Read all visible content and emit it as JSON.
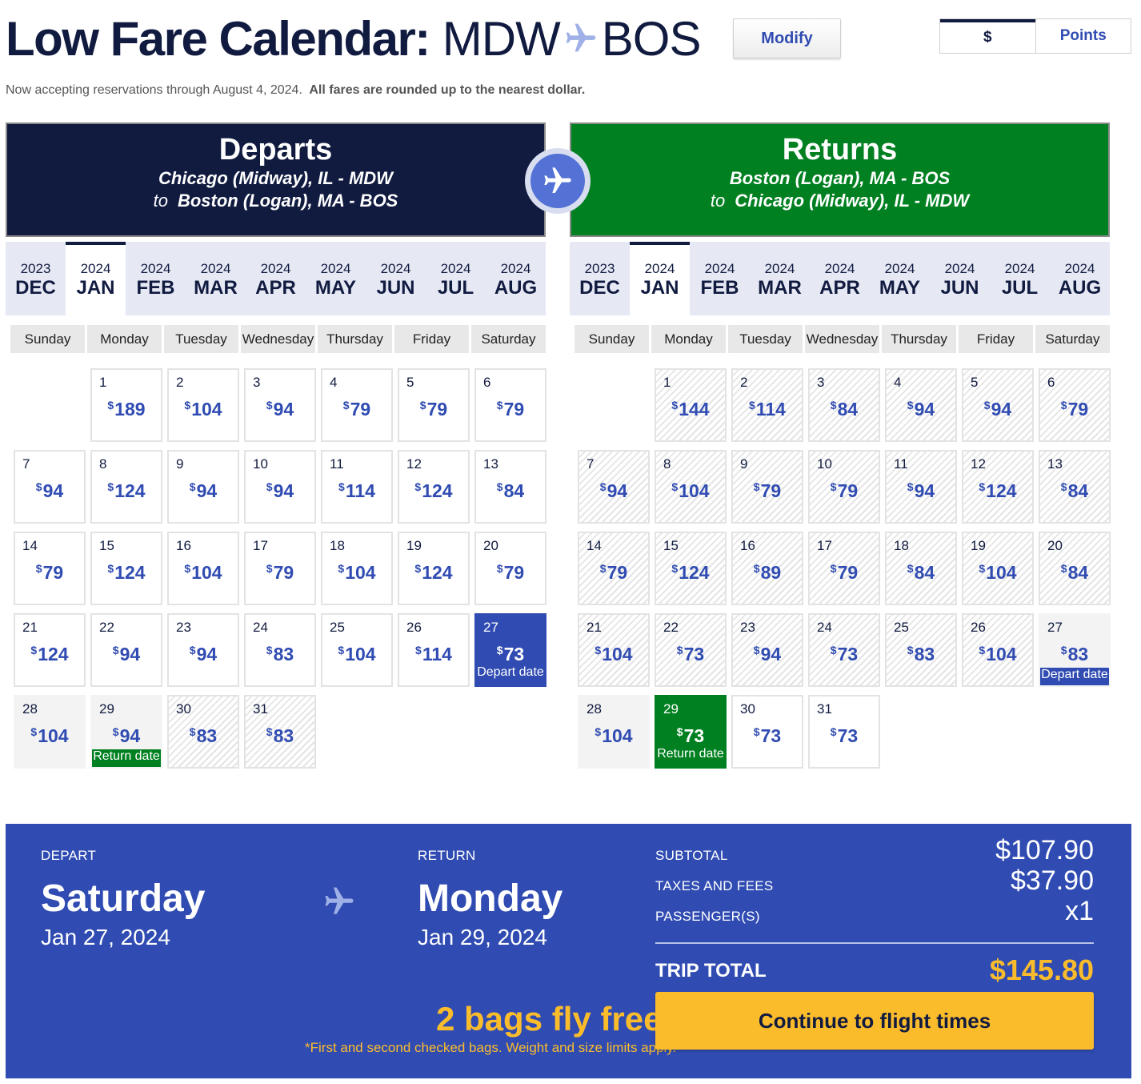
{
  "header": {
    "title": "Low Fare Calendar:",
    "origin": "MDW",
    "destination": "BOS",
    "modify_label": "Modify",
    "currency_options": [
      "$",
      "Points"
    ],
    "currency_selected": "$"
  },
  "notice": {
    "text": "Now accepting reservations through August 4, 2024.",
    "bold": "All fares are rounded up to the nearest dollar."
  },
  "colors": {
    "navy": "#111b40",
    "blue": "#304cb2",
    "green": "#008020",
    "yellow": "#fbbc2c"
  },
  "depart": {
    "heading": "Departs",
    "from": "Chicago (Midway), IL - MDW",
    "to_word": "to",
    "to": "Boston (Logan), MA - BOS",
    "months": [
      {
        "year": "2023",
        "name": "DEC"
      },
      {
        "year": "2024",
        "name": "JAN"
      },
      {
        "year": "2024",
        "name": "FEB"
      },
      {
        "year": "2024",
        "name": "MAR"
      },
      {
        "year": "2024",
        "name": "APR"
      },
      {
        "year": "2024",
        "name": "MAY"
      },
      {
        "year": "2024",
        "name": "JUN"
      },
      {
        "year": "2024",
        "name": "JUL"
      },
      {
        "year": "2024",
        "name": "AUG"
      }
    ],
    "active_month": "JAN",
    "weekdays": [
      "Sunday",
      "Monday",
      "Tuesday",
      "Wednesday",
      "Thursday",
      "Friday",
      "Saturday"
    ],
    "first_weekday": 1,
    "days": [
      {
        "day": "1",
        "fare": "189"
      },
      {
        "day": "2",
        "fare": "104"
      },
      {
        "day": "3",
        "fare": "94"
      },
      {
        "day": "4",
        "fare": "79"
      },
      {
        "day": "5",
        "fare": "79"
      },
      {
        "day": "6",
        "fare": "79"
      },
      {
        "day": "7",
        "fare": "94"
      },
      {
        "day": "8",
        "fare": "124"
      },
      {
        "day": "9",
        "fare": "94"
      },
      {
        "day": "10",
        "fare": "94"
      },
      {
        "day": "11",
        "fare": "114"
      },
      {
        "day": "12",
        "fare": "124"
      },
      {
        "day": "13",
        "fare": "84"
      },
      {
        "day": "14",
        "fare": "79"
      },
      {
        "day": "15",
        "fare": "124"
      },
      {
        "day": "16",
        "fare": "104"
      },
      {
        "day": "17",
        "fare": "79"
      },
      {
        "day": "18",
        "fare": "104"
      },
      {
        "day": "19",
        "fare": "124"
      },
      {
        "day": "20",
        "fare": "79"
      },
      {
        "day": "21",
        "fare": "124"
      },
      {
        "day": "22",
        "fare": "94"
      },
      {
        "day": "23",
        "fare": "94"
      },
      {
        "day": "24",
        "fare": "83"
      },
      {
        "day": "25",
        "fare": "104"
      },
      {
        "day": "26",
        "fare": "114"
      },
      {
        "day": "27",
        "fare": "73",
        "state": "selected",
        "tag": "Depart date"
      },
      {
        "day": "28",
        "fare": "104",
        "state": "range"
      },
      {
        "day": "29",
        "fare": "94",
        "state": "range",
        "tag": "Return date",
        "tagbox": "green"
      },
      {
        "day": "30",
        "fare": "83",
        "state": "hatched"
      },
      {
        "day": "31",
        "fare": "83",
        "state": "hatched"
      }
    ]
  },
  "return": {
    "heading": "Returns",
    "from": "Boston (Logan), MA - BOS",
    "to_word": "to",
    "to": "Chicago (Midway), IL - MDW",
    "months": [
      {
        "year": "2023",
        "name": "DEC"
      },
      {
        "year": "2024",
        "name": "JAN"
      },
      {
        "year": "2024",
        "name": "FEB"
      },
      {
        "year": "2024",
        "name": "MAR"
      },
      {
        "year": "2024",
        "name": "APR"
      },
      {
        "year": "2024",
        "name": "MAY"
      },
      {
        "year": "2024",
        "name": "JUN"
      },
      {
        "year": "2024",
        "name": "JUL"
      },
      {
        "year": "2024",
        "name": "AUG"
      }
    ],
    "active_month": "JAN",
    "weekdays": [
      "Sunday",
      "Monday",
      "Tuesday",
      "Wednesday",
      "Thursday",
      "Friday",
      "Saturday"
    ],
    "first_weekday": 1,
    "days": [
      {
        "day": "1",
        "fare": "144",
        "state": "hatched"
      },
      {
        "day": "2",
        "fare": "114",
        "state": "hatched"
      },
      {
        "day": "3",
        "fare": "84",
        "state": "hatched"
      },
      {
        "day": "4",
        "fare": "94",
        "state": "hatched"
      },
      {
        "day": "5",
        "fare": "94",
        "state": "hatched"
      },
      {
        "day": "6",
        "fare": "79",
        "state": "hatched"
      },
      {
        "day": "7",
        "fare": "94",
        "state": "hatched"
      },
      {
        "day": "8",
        "fare": "104",
        "state": "hatched"
      },
      {
        "day": "9",
        "fare": "79",
        "state": "hatched"
      },
      {
        "day": "10",
        "fare": "79",
        "state": "hatched"
      },
      {
        "day": "11",
        "fare": "94",
        "state": "hatched"
      },
      {
        "day": "12",
        "fare": "124",
        "state": "hatched"
      },
      {
        "day": "13",
        "fare": "84",
        "state": "hatched"
      },
      {
        "day": "14",
        "fare": "79",
        "state": "hatched"
      },
      {
        "day": "15",
        "fare": "124",
        "state": "hatched"
      },
      {
        "day": "16",
        "fare": "89",
        "state": "hatched"
      },
      {
        "day": "17",
        "fare": "79",
        "state": "hatched"
      },
      {
        "day": "18",
        "fare": "84",
        "state": "hatched"
      },
      {
        "day": "19",
        "fare": "104",
        "state": "hatched"
      },
      {
        "day": "20",
        "fare": "84",
        "state": "hatched"
      },
      {
        "day": "21",
        "fare": "104",
        "state": "hatched"
      },
      {
        "day": "22",
        "fare": "73",
        "state": "hatched"
      },
      {
        "day": "23",
        "fare": "94",
        "state": "hatched"
      },
      {
        "day": "24",
        "fare": "73",
        "state": "hatched"
      },
      {
        "day": "25",
        "fare": "83",
        "state": "hatched"
      },
      {
        "day": "26",
        "fare": "104",
        "state": "hatched"
      },
      {
        "day": "27",
        "fare": "83",
        "state": "range",
        "tag": "Depart date",
        "tagbox": "blue"
      },
      {
        "day": "28",
        "fare": "104",
        "state": "range"
      },
      {
        "day": "29",
        "fare": "73",
        "state": "selected-green",
        "tag": "Return date"
      },
      {
        "day": "30",
        "fare": "73"
      },
      {
        "day": "31",
        "fare": "73"
      }
    ]
  },
  "summary": {
    "depart_label": "DEPART",
    "depart_day": "Saturday",
    "depart_date": "Jan 27, 2024",
    "return_label": "RETURN",
    "return_day": "Monday",
    "return_date": "Jan 29, 2024",
    "subtotal_label": "SUBTOTAL",
    "subtotal": "$107.90",
    "taxes_label": "TAXES AND FEES",
    "taxes": "$37.90",
    "passengers_label": "PASSENGER(S)",
    "passengers": "x1",
    "total_label": "TRIP TOTAL",
    "total": "$145.80",
    "bags_headline": "2 bags fly free",
    "bags_note": "*First and second checked bags. Weight and size limits apply.",
    "continue_label": "Continue to flight times"
  }
}
